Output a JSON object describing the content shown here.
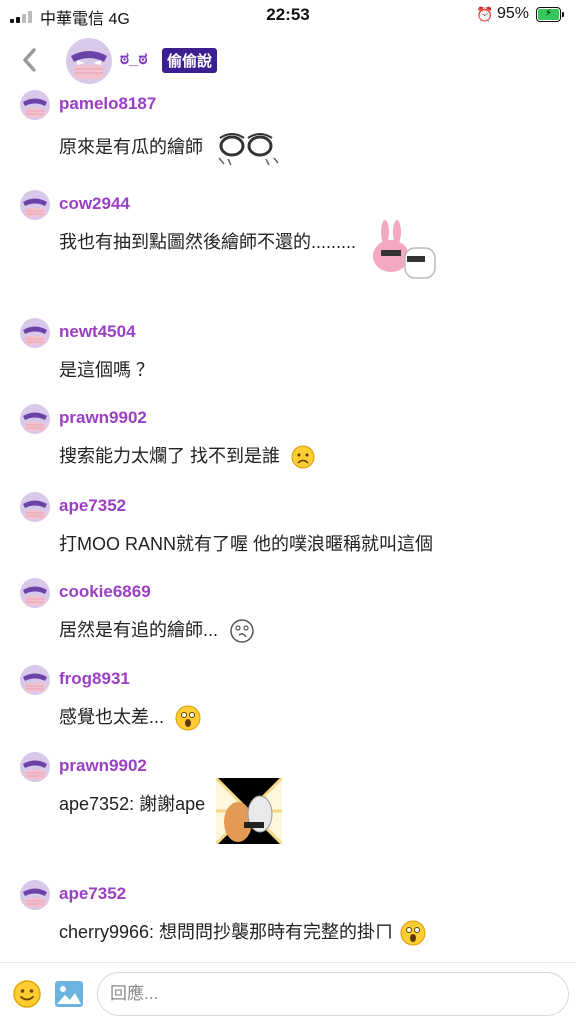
{
  "status_bar": {
    "carrier": "中華電信  4G",
    "time": "22:53",
    "battery": "95%"
  },
  "header": {
    "back_icon": "chevron-left-icon",
    "title": "ಠ_ಠ",
    "badge": "偷偷說"
  },
  "colors": {
    "username": "#9b3fc4",
    "badge_bg": "#3e1f92",
    "avatar_purple": "#8a63b8",
    "avatar_pink": "#f1b7c6"
  },
  "messages": [
    {
      "user": "pamelo8187",
      "text": "原來是有瓜的繪師",
      "sticker": "sweat-face-sticker"
    },
    {
      "user": "cow2944",
      "text": "我也有抽到點圖然後繪師不還的.........",
      "sticker": "pink-rabbit-sticker"
    },
    {
      "user": "newt4504",
      "text": "是這個嗎 ？"
    },
    {
      "user": "prawn9902",
      "text": "搜索能力太爛了 找不到是誰",
      "sticker": "sad-face-emoji"
    },
    {
      "user": "ape7352",
      "text": "打MOO RANN就有了喔 他的噗浪暱稱就叫這個"
    },
    {
      "user": "cookie6869",
      "text": "居然是有追的繪師...",
      "sticker": "thinking-face-emoji"
    },
    {
      "user": "frog8931",
      "text": "感覺也太差...",
      "sticker": "shocked-face-emoji"
    },
    {
      "user": "prawn9902",
      "text": "ape7352: 謝謝ape",
      "sticker": "animals-sticker"
    },
    {
      "user": "ape7352",
      "text": "cherry9966: 想問問抄襲那時有完整的掛ㄇ",
      "sticker": "shocked-face-emoji"
    }
  ],
  "input_bar": {
    "placeholder": "回應...",
    "emoji_icon": "smile-icon",
    "image_icon": "image-icon"
  }
}
